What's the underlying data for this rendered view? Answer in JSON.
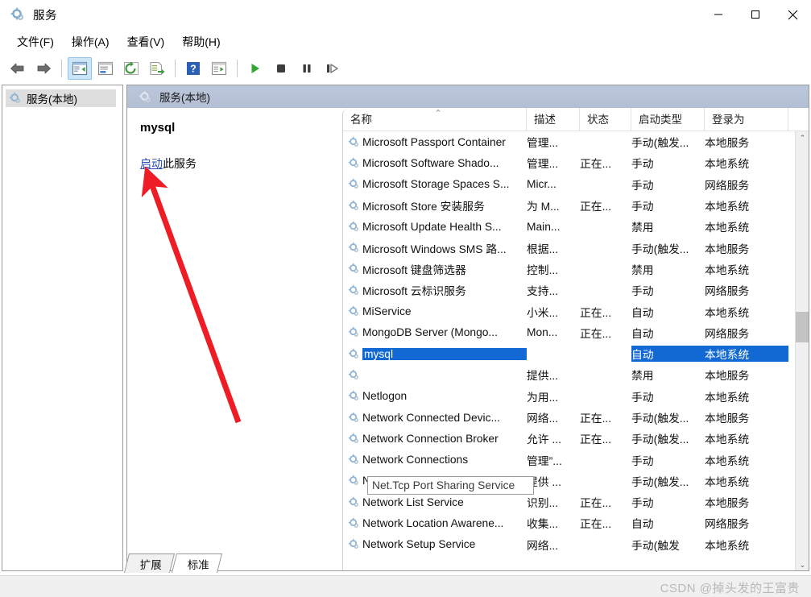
{
  "window": {
    "title": "服务",
    "icon": "services-gear-icon",
    "minimize_label": "–",
    "maximize_label": "□",
    "close_label": "✕"
  },
  "menubar": {
    "items": [
      {
        "label": "文件(F)",
        "name": "menu-file"
      },
      {
        "label": "操作(A)",
        "name": "menu-action"
      },
      {
        "label": "查看(V)",
        "name": "menu-view"
      },
      {
        "label": "帮助(H)",
        "name": "menu-help"
      }
    ]
  },
  "toolbar": {
    "buttons": [
      {
        "name": "back-arrow-icon",
        "tip": "后退"
      },
      {
        "name": "forward-arrow-icon",
        "tip": "前进"
      },
      {
        "name": "show-hide-console-tree-icon",
        "tip": "显示/隐藏控制台树",
        "active": true
      },
      {
        "name": "properties-icon",
        "tip": "属性"
      },
      {
        "name": "refresh-icon",
        "tip": "刷新"
      },
      {
        "name": "export-list-icon",
        "tip": "导出列表"
      },
      {
        "name": "help-icon",
        "tip": "帮助"
      },
      {
        "name": "show-action-pane-icon",
        "tip": "显示/隐藏操作窗格"
      },
      {
        "name": "start-service-icon",
        "tip": "启动服务"
      },
      {
        "name": "stop-service-icon",
        "tip": "停止服务"
      },
      {
        "name": "pause-service-icon",
        "tip": "暂停服务"
      },
      {
        "name": "restart-service-icon",
        "tip": "重启服务"
      }
    ]
  },
  "tree": {
    "nodes": [
      {
        "label": "服务(本地)",
        "icon": "services-gear-icon",
        "selected": true
      }
    ]
  },
  "pane_header": {
    "title": "服务(本地)",
    "icon": "services-gear-icon"
  },
  "detail": {
    "service_name": "mysql",
    "action_link": "启动",
    "action_suffix": "此服务"
  },
  "list": {
    "columns": [
      {
        "key": "name",
        "label": "名称",
        "sorted": true
      },
      {
        "key": "desc",
        "label": "描述",
        "sorted": false
      },
      {
        "key": "status",
        "label": "状态",
        "sorted": false
      },
      {
        "key": "start",
        "label": "启动类型",
        "sorted": false
      },
      {
        "key": "logon",
        "label": "登录为",
        "sorted": false
      }
    ],
    "rows": [
      {
        "name": "Microsoft Passport Container",
        "desc": "管理...",
        "status": "",
        "start": "手动(触发...",
        "logon": "本地服务",
        "selected": false
      },
      {
        "name": "Microsoft Software Shado...",
        "desc": "管理...",
        "status": "正在...",
        "start": "手动",
        "logon": "本地系统",
        "selected": false
      },
      {
        "name": "Microsoft Storage Spaces S...",
        "desc": "Micr...",
        "status": "",
        "start": "手动",
        "logon": "网络服务",
        "selected": false
      },
      {
        "name": "Microsoft Store 安装服务",
        "desc": "为 M...",
        "status": "正在...",
        "start": "手动",
        "logon": "本地系统",
        "selected": false
      },
      {
        "name": "Microsoft Update Health S...",
        "desc": "Main...",
        "status": "",
        "start": "禁用",
        "logon": "本地系统",
        "selected": false
      },
      {
        "name": "Microsoft Windows SMS 路...",
        "desc": "根据...",
        "status": "",
        "start": "手动(触发...",
        "logon": "本地服务",
        "selected": false
      },
      {
        "name": "Microsoft 键盘筛选器",
        "desc": "控制...",
        "status": "",
        "start": "禁用",
        "logon": "本地系统",
        "selected": false
      },
      {
        "name": "Microsoft 云标识服务",
        "desc": "支持...",
        "status": "",
        "start": "手动",
        "logon": "网络服务",
        "selected": false
      },
      {
        "name": "MiService",
        "desc": "小米...",
        "status": "正在...",
        "start": "自动",
        "logon": "本地系统",
        "selected": false
      },
      {
        "name": "MongoDB Server (Mongo...",
        "desc": "Mon...",
        "status": "正在...",
        "start": "自动",
        "logon": "网络服务",
        "selected": false
      },
      {
        "name": "mysql",
        "desc": "",
        "status": "",
        "start": "自动",
        "logon": "本地系统",
        "selected": true
      },
      {
        "name": "",
        "desc": "提供...",
        "status": "",
        "start": "禁用",
        "logon": "本地服务",
        "selected": false
      },
      {
        "name": "Netlogon",
        "desc": "为用...",
        "status": "",
        "start": "手动",
        "logon": "本地系统",
        "selected": false
      },
      {
        "name": "Network Connected Devic...",
        "desc": "网络...",
        "status": "正在...",
        "start": "手动(触发...",
        "logon": "本地服务",
        "selected": false
      },
      {
        "name": "Network Connection Broker",
        "desc": "允许 ...",
        "status": "正在...",
        "start": "手动(触发...",
        "logon": "本地系统",
        "selected": false
      },
      {
        "name": "Network Connections",
        "desc": "管理”...",
        "status": "",
        "start": "手动",
        "logon": "本地系统",
        "selected": false
      },
      {
        "name": "Network Connectivity Assis...",
        "desc": "提供 ...",
        "status": "",
        "start": "手动(触发...",
        "logon": "本地系统",
        "selected": false
      },
      {
        "name": "Network List Service",
        "desc": "识别...",
        "status": "正在...",
        "start": "手动",
        "logon": "本地服务",
        "selected": false
      },
      {
        "name": "Network Location Awarene...",
        "desc": "收集...",
        "status": "正在...",
        "start": "自动",
        "logon": "网络服务",
        "selected": false
      },
      {
        "name": "Network Setup Service",
        "desc": "网络...",
        "status": "",
        "start": "手动(触发",
        "logon": "本地系统",
        "selected": false
      }
    ],
    "tooltip": "Net.Tcp Port Sharing Service",
    "scroll_up_glyph": "⌃",
    "scroll_down_glyph": "⌄"
  },
  "tabs": [
    {
      "label": "扩展",
      "active": false
    },
    {
      "label": "标准",
      "active": true
    }
  ],
  "watermark": "CSDN @掉头发的王富贵",
  "colors": {
    "selection": "#1269d3",
    "link": "#2a4fb8",
    "header_gradient_top": "#bdc7db",
    "annotation_red": "#ee1c25",
    "toolbar_active": "#cde6f7"
  }
}
